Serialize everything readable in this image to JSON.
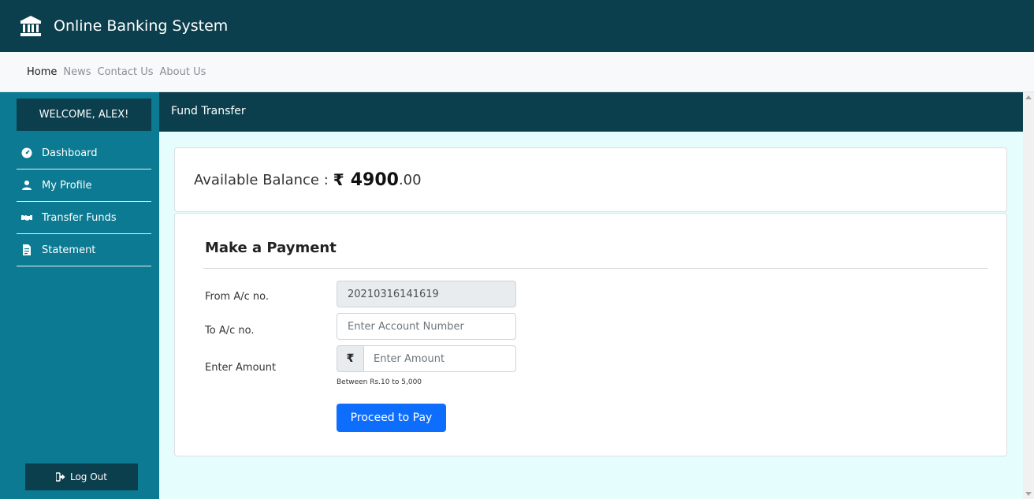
{
  "app": {
    "title": "Online Banking System",
    "logo_icon": "bank-icon"
  },
  "nav": {
    "items": [
      {
        "label": "Home",
        "active": true
      },
      {
        "label": "News"
      },
      {
        "label": "Contact Us"
      },
      {
        "label": "About Us"
      }
    ]
  },
  "sidebar": {
    "welcome": "WELCOME, ALEX!",
    "items": [
      {
        "label": "Dashboard",
        "icon": "dashboard-icon"
      },
      {
        "label": "My Profile",
        "icon": "user-icon"
      },
      {
        "label": "Transfer Funds",
        "icon": "handshake-icon"
      },
      {
        "label": "Statement",
        "icon": "document-icon"
      }
    ],
    "logout_label": "Log Out",
    "logout_icon": "sign-out-icon"
  },
  "page": {
    "header": "Fund Transfer"
  },
  "balance": {
    "label": "Available Balance :",
    "currency_symbol": "₹",
    "amount_int": "4900",
    "amount_dec": ".00"
  },
  "payment": {
    "title": "Make a Payment",
    "from_label": "From A/c no.",
    "from_value": "20210316141619",
    "to_label": "To A/c no.",
    "to_placeholder": "Enter Account Number",
    "amount_label": "Enter Amount",
    "amount_prefix": "₹",
    "amount_placeholder": "Enter Amount",
    "amount_hint": "Between Rs.10 to 5,000",
    "submit_label": "Proceed to Pay"
  },
  "colors": {
    "header_dark": "#0b3f4d",
    "sidebar_teal": "#0b7a92",
    "main_bg": "#e5fdfd",
    "primary_button": "#0d6efd"
  }
}
